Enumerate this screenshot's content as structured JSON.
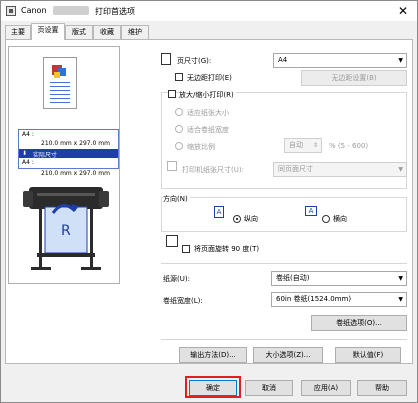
{
  "window": {
    "title_prefix": "Canon",
    "title_suffix": "打印首选项",
    "close": "✕"
  },
  "tabs": [
    "主要",
    "页设置",
    "版式",
    "收藏",
    "维护"
  ],
  "preview": {
    "size_line1": "A4 :",
    "size_line2": "210.0 mm x 297.0 mm",
    "size_arrow_label": "实际尺寸",
    "size_line3": "A4 :",
    "size_line4": "210.0 mm x 297.0 mm"
  },
  "page_size": {
    "label": "页尺寸(G):",
    "value": "A4"
  },
  "borderless": {
    "label": "无边距打印(E)",
    "button": "无边距设置(B)"
  },
  "scaled": {
    "label": "放大/缩小打印(R)",
    "opt_fit_paper": "适应纸张大小",
    "opt_fit_roll": "适合卷纸宽度",
    "opt_scale": "缩放比例",
    "scale_value": "自动",
    "scale_range": "% (5 - 600)"
  },
  "output_size": {
    "label": "打印机纸张尺寸(U):",
    "value": "同页面尺寸"
  },
  "orientation": {
    "label": "方向(N)",
    "portrait": "纵向",
    "landscape": "横向"
  },
  "rotate": {
    "label": "将页面旋转 90 度(T)"
  },
  "paper_source": {
    "label": "纸源(U):",
    "value": "卷纸(自动)"
  },
  "roll_width": {
    "label": "卷纸宽度(L):",
    "value": "60in 卷纸(1524.0mm)"
  },
  "buttons": {
    "roll_options": "卷纸选项(O)...",
    "output_method": "输出方法(D)...",
    "size_options": "大小选项(Z)...",
    "defaults": "默认值(F)"
  },
  "footer": {
    "ok": "确定",
    "cancel": "取消",
    "apply": "应用(A)",
    "help": "帮助"
  }
}
